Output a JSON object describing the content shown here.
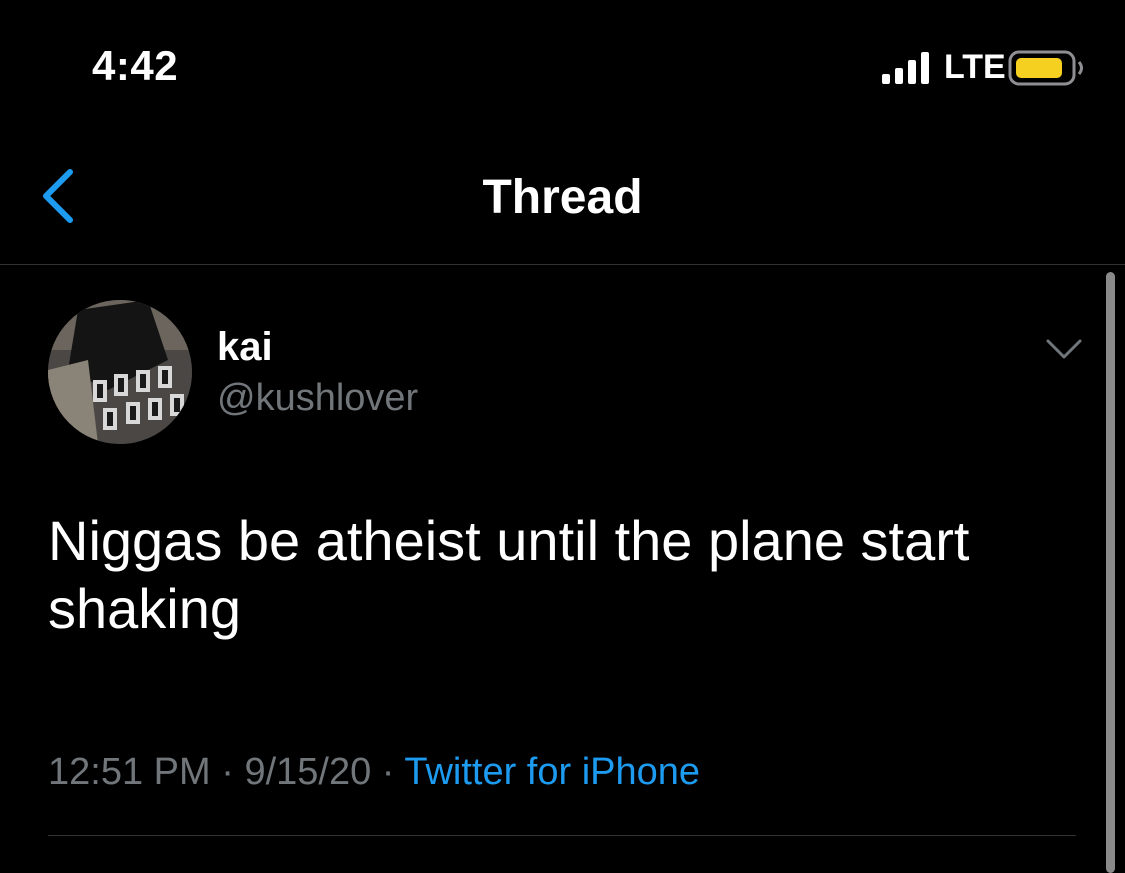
{
  "status_bar": {
    "time": "4:42",
    "network": "LTE",
    "battery_color": "#f5d020"
  },
  "nav": {
    "title": "Thread",
    "back_icon": "chevron-left-icon",
    "accent": "#1d9bf0"
  },
  "tweet": {
    "display_name": "kai",
    "handle": "@kushlover",
    "text": "Niggas be atheist until the plane start shaking",
    "time": "12:51 PM",
    "date": "9/15/20",
    "separator": "·",
    "source": "Twitter for iPhone",
    "menu_icon": "chevron-down-icon"
  }
}
